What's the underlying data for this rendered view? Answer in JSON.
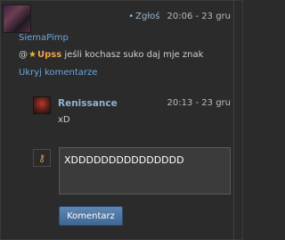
{
  "top_comment": {
    "author": "SiemaPimp",
    "report_label": "Zgłoś",
    "time": "20:06 - 23 gru",
    "message": {
      "prefix": "@",
      "star": "★",
      "mention": "Upss",
      "text": "jeśli kochasz suko daj mje znak"
    },
    "toggle_label": "Ukryj komentarze",
    "avatar": "user-avatar-anime"
  },
  "reply": {
    "author": "Renissance",
    "time": "20:13 - 23 gru",
    "message": "xD",
    "avatar": "user-avatar-red"
  },
  "composer": {
    "value": "XDDDDDDDDDDDDDDD",
    "avatar_icon": "key-icon",
    "submit_label": "Komentarz"
  },
  "colors": {
    "background": "#2b2b2b",
    "link": "#6ba6e0",
    "mention": "#f0a24a",
    "button": "#4f77a3"
  }
}
